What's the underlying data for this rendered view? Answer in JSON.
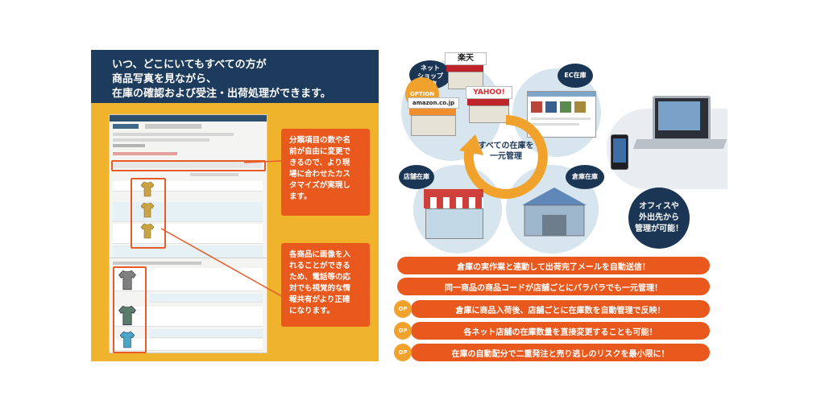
{
  "left": {
    "header_lines": [
      "いつ、どこにいてもすべての方が",
      "商品写真を見ながら、",
      "在庫の確認および受注・出荷処理ができます。"
    ],
    "callout1": [
      "分類項目の数や名",
      "前が自由に変更で",
      "きるので、より現",
      "場に合わせたカス",
      "タマイズが実現し",
      "ます。"
    ],
    "callout2": [
      "各商品に画像を入",
      "れることができる",
      "ため、電話等の応",
      "対でも視覚的な情",
      "報共有がより正確",
      "になります。"
    ]
  },
  "right": {
    "locations": {
      "netshop": [
        "ネット",
        "ショップ",
        "在庫"
      ],
      "option": "OPTION",
      "ec": "EC在庫",
      "store": "店舗在庫",
      "warehouse": "倉庫在庫"
    },
    "logos": {
      "rakuten": "楽天",
      "yahoo": "YAHOO!",
      "amazon": "amazon.co.jp"
    },
    "center_label": [
      "すべての在庫を",
      "一元管理"
    ],
    "office_label": [
      "オフィスや",
      "外出先から",
      "管理が可能！"
    ],
    "features": [
      {
        "text": "倉庫の実作業と連動して出荷完了メールを自動送信！",
        "badge": ""
      },
      {
        "text": "同一商品の商品コードが店舗ごとにバラバラでも一元管理！",
        "badge": ""
      },
      {
        "text": "倉庫に商品入荷後、店舗ごとに在庫数を自動管理で反映！",
        "badge": "OP"
      },
      {
        "text": "各ネット店舗の在庫数量を直接変更することも可能！",
        "badge": "OP"
      },
      {
        "text": "在庫の自動配分で二重発注と売り逃しのリスクを最小限に！",
        "badge": "OP"
      }
    ]
  },
  "colors": {
    "navy": "#1d3b5c",
    "gold": "#f0b32c",
    "orange": "#e9581d",
    "circle_blue": "#d7e6ee"
  }
}
